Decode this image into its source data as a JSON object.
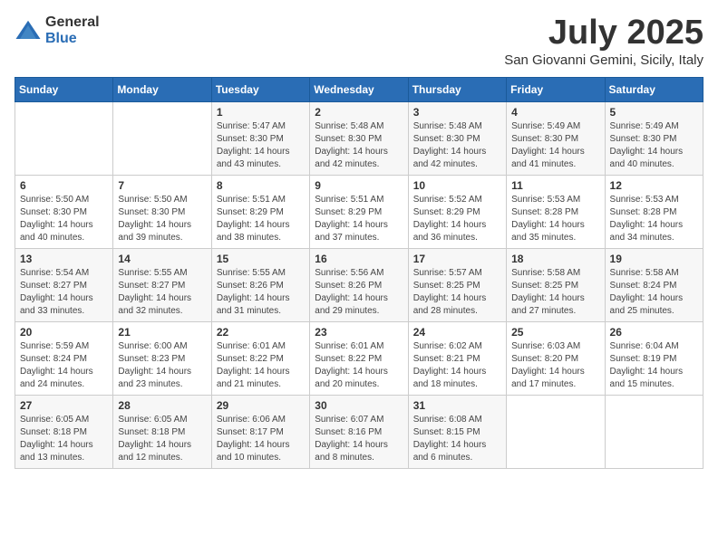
{
  "header": {
    "logo_general": "General",
    "logo_blue": "Blue",
    "month_title": "July 2025",
    "location": "San Giovanni Gemini, Sicily, Italy"
  },
  "weekdays": [
    "Sunday",
    "Monday",
    "Tuesday",
    "Wednesday",
    "Thursday",
    "Friday",
    "Saturday"
  ],
  "weeks": [
    [
      {
        "day": "",
        "content": ""
      },
      {
        "day": "",
        "content": ""
      },
      {
        "day": "1",
        "content": "Sunrise: 5:47 AM\nSunset: 8:30 PM\nDaylight: 14 hours\nand 43 minutes."
      },
      {
        "day": "2",
        "content": "Sunrise: 5:48 AM\nSunset: 8:30 PM\nDaylight: 14 hours\nand 42 minutes."
      },
      {
        "day": "3",
        "content": "Sunrise: 5:48 AM\nSunset: 8:30 PM\nDaylight: 14 hours\nand 42 minutes."
      },
      {
        "day": "4",
        "content": "Sunrise: 5:49 AM\nSunset: 8:30 PM\nDaylight: 14 hours\nand 41 minutes."
      },
      {
        "day": "5",
        "content": "Sunrise: 5:49 AM\nSunset: 8:30 PM\nDaylight: 14 hours\nand 40 minutes."
      }
    ],
    [
      {
        "day": "6",
        "content": "Sunrise: 5:50 AM\nSunset: 8:30 PM\nDaylight: 14 hours\nand 40 minutes."
      },
      {
        "day": "7",
        "content": "Sunrise: 5:50 AM\nSunset: 8:30 PM\nDaylight: 14 hours\nand 39 minutes."
      },
      {
        "day": "8",
        "content": "Sunrise: 5:51 AM\nSunset: 8:29 PM\nDaylight: 14 hours\nand 38 minutes."
      },
      {
        "day": "9",
        "content": "Sunrise: 5:51 AM\nSunset: 8:29 PM\nDaylight: 14 hours\nand 37 minutes."
      },
      {
        "day": "10",
        "content": "Sunrise: 5:52 AM\nSunset: 8:29 PM\nDaylight: 14 hours\nand 36 minutes."
      },
      {
        "day": "11",
        "content": "Sunrise: 5:53 AM\nSunset: 8:28 PM\nDaylight: 14 hours\nand 35 minutes."
      },
      {
        "day": "12",
        "content": "Sunrise: 5:53 AM\nSunset: 8:28 PM\nDaylight: 14 hours\nand 34 minutes."
      }
    ],
    [
      {
        "day": "13",
        "content": "Sunrise: 5:54 AM\nSunset: 8:27 PM\nDaylight: 14 hours\nand 33 minutes."
      },
      {
        "day": "14",
        "content": "Sunrise: 5:55 AM\nSunset: 8:27 PM\nDaylight: 14 hours\nand 32 minutes."
      },
      {
        "day": "15",
        "content": "Sunrise: 5:55 AM\nSunset: 8:26 PM\nDaylight: 14 hours\nand 31 minutes."
      },
      {
        "day": "16",
        "content": "Sunrise: 5:56 AM\nSunset: 8:26 PM\nDaylight: 14 hours\nand 29 minutes."
      },
      {
        "day": "17",
        "content": "Sunrise: 5:57 AM\nSunset: 8:25 PM\nDaylight: 14 hours\nand 28 minutes."
      },
      {
        "day": "18",
        "content": "Sunrise: 5:58 AM\nSunset: 8:25 PM\nDaylight: 14 hours\nand 27 minutes."
      },
      {
        "day": "19",
        "content": "Sunrise: 5:58 AM\nSunset: 8:24 PM\nDaylight: 14 hours\nand 25 minutes."
      }
    ],
    [
      {
        "day": "20",
        "content": "Sunrise: 5:59 AM\nSunset: 8:24 PM\nDaylight: 14 hours\nand 24 minutes."
      },
      {
        "day": "21",
        "content": "Sunrise: 6:00 AM\nSunset: 8:23 PM\nDaylight: 14 hours\nand 23 minutes."
      },
      {
        "day": "22",
        "content": "Sunrise: 6:01 AM\nSunset: 8:22 PM\nDaylight: 14 hours\nand 21 minutes."
      },
      {
        "day": "23",
        "content": "Sunrise: 6:01 AM\nSunset: 8:22 PM\nDaylight: 14 hours\nand 20 minutes."
      },
      {
        "day": "24",
        "content": "Sunrise: 6:02 AM\nSunset: 8:21 PM\nDaylight: 14 hours\nand 18 minutes."
      },
      {
        "day": "25",
        "content": "Sunrise: 6:03 AM\nSunset: 8:20 PM\nDaylight: 14 hours\nand 17 minutes."
      },
      {
        "day": "26",
        "content": "Sunrise: 6:04 AM\nSunset: 8:19 PM\nDaylight: 14 hours\nand 15 minutes."
      }
    ],
    [
      {
        "day": "27",
        "content": "Sunrise: 6:05 AM\nSunset: 8:18 PM\nDaylight: 14 hours\nand 13 minutes."
      },
      {
        "day": "28",
        "content": "Sunrise: 6:05 AM\nSunset: 8:18 PM\nDaylight: 14 hours\nand 12 minutes."
      },
      {
        "day": "29",
        "content": "Sunrise: 6:06 AM\nSunset: 8:17 PM\nDaylight: 14 hours\nand 10 minutes."
      },
      {
        "day": "30",
        "content": "Sunrise: 6:07 AM\nSunset: 8:16 PM\nDaylight: 14 hours\nand 8 minutes."
      },
      {
        "day": "31",
        "content": "Sunrise: 6:08 AM\nSunset: 8:15 PM\nDaylight: 14 hours\nand 6 minutes."
      },
      {
        "day": "",
        "content": ""
      },
      {
        "day": "",
        "content": ""
      }
    ]
  ]
}
